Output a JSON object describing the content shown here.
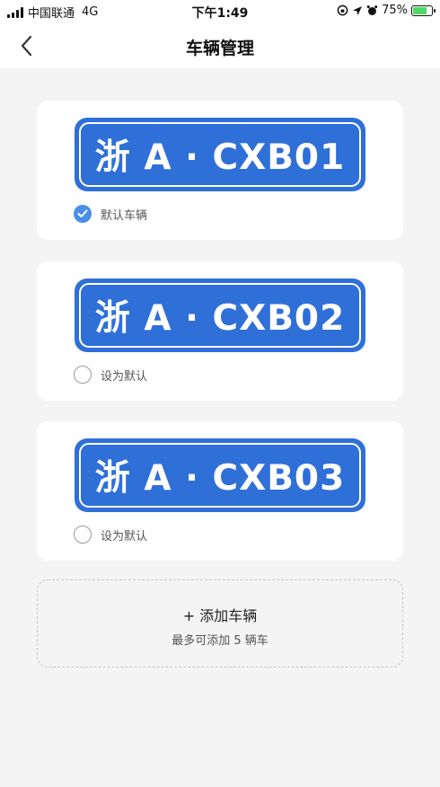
{
  "status_bar": {
    "carrier": "中国联通",
    "network": "4G",
    "time": "下午1:49",
    "battery": "75%",
    "battery_level": 0.75
  },
  "nav": {
    "title": "车辆管理",
    "back_icon": "chevron-left-icon"
  },
  "vehicles": [
    {
      "plate": "浙 A · CXB01",
      "default_label": "默认车辆",
      "is_default": true
    },
    {
      "plate": "浙 A · CXB02",
      "default_label": "设为默认",
      "is_default": false
    },
    {
      "plate": "浙 A · CXB03",
      "default_label": "设为默认",
      "is_default": false
    }
  ],
  "add_vehicle": {
    "label": "+ 添加车辆",
    "hint": "最多可添加 5 辆车"
  },
  "colors": {
    "plate_blue": "#2f6fd8",
    "check_blue": "#4a8fe7",
    "background": "#f4f4f4"
  }
}
